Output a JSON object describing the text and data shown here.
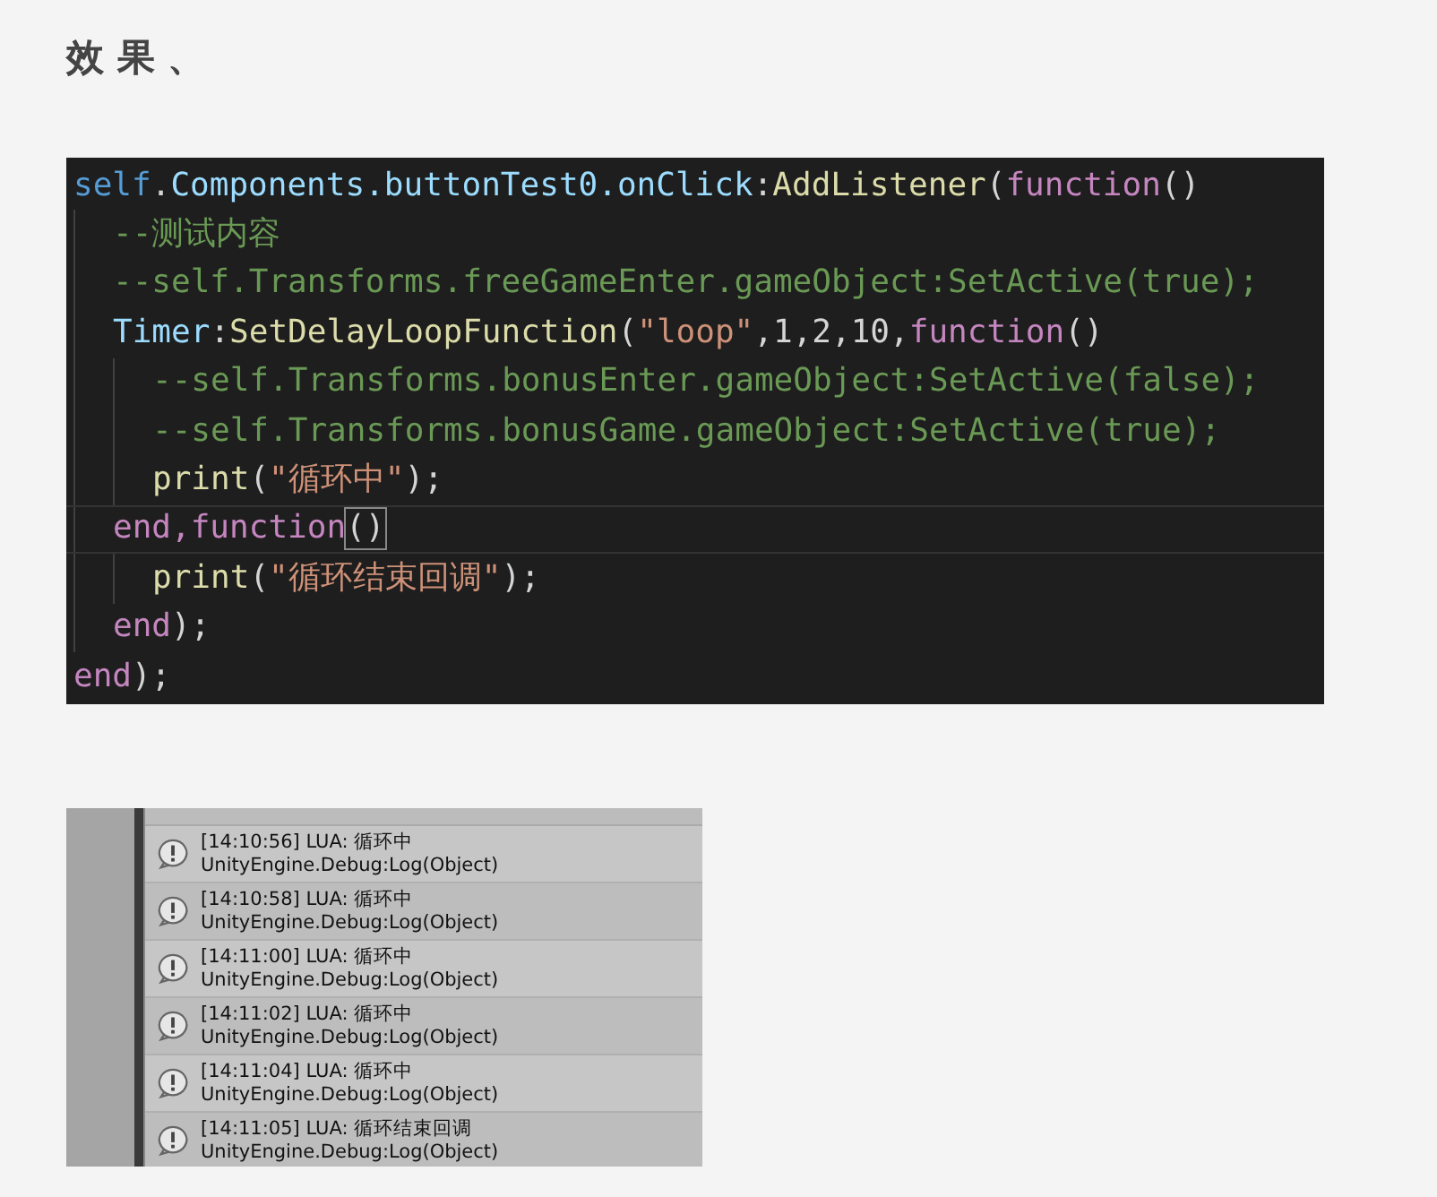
{
  "heading": "效 果 、",
  "code": {
    "lines": [
      {
        "current": false,
        "tokens": [
          {
            "kind": "self",
            "text": "self"
          },
          {
            "kind": "plain",
            "text": "."
          },
          {
            "kind": "member",
            "text": "Components.buttonTest0.onClick"
          },
          {
            "kind": "plain",
            "text": ":"
          },
          {
            "kind": "func",
            "text": "AddListener"
          },
          {
            "kind": "plain",
            "text": "("
          },
          {
            "kind": "keyword",
            "text": "function"
          },
          {
            "kind": "plain",
            "text": "()"
          }
        ],
        "children": [
          {
            "current": false,
            "tokens": [
              {
                "kind": "comment",
                "text": "--测试内容"
              }
            ]
          },
          {
            "current": false,
            "tokens": [
              {
                "kind": "comment",
                "text": "--self.Transforms.freeGameEnter.gameObject:SetActive(true);"
              }
            ]
          },
          {
            "current": false,
            "tokens": [
              {
                "kind": "member",
                "text": "Timer"
              },
              {
                "kind": "plain",
                "text": ":"
              },
              {
                "kind": "func",
                "text": "SetDelayLoopFunction"
              },
              {
                "kind": "plain",
                "text": "("
              },
              {
                "kind": "string",
                "text": "\"loop\""
              },
              {
                "kind": "plain",
                "text": ",1,2,10,"
              },
              {
                "kind": "keyword",
                "text": "function"
              },
              {
                "kind": "plain",
                "text": "()"
              }
            ],
            "children": [
              {
                "current": false,
                "tokens": [
                  {
                    "kind": "comment",
                    "text": "--self.Transforms.bonusEnter.gameObject:SetActive(false);"
                  }
                ]
              },
              {
                "current": false,
                "tokens": [
                  {
                    "kind": "comment",
                    "text": "--self.Transforms.bonusGame.gameObject:SetActive(true);"
                  }
                ]
              },
              {
                "current": false,
                "tokens": [
                  {
                    "kind": "func",
                    "text": "print"
                  },
                  {
                    "kind": "plain",
                    "text": "("
                  },
                  {
                    "kind": "string",
                    "text": "\"循环中\""
                  },
                  {
                    "kind": "plain",
                    "text": ");"
                  }
                ]
              }
            ]
          },
          {
            "current": true,
            "tokens": [
              {
                "kind": "keyword",
                "text": "end,function"
              },
              {
                "kind": "bracket",
                "text": "()"
              }
            ],
            "children": [
              {
                "current": false,
                "tokens": [
                  {
                    "kind": "func",
                    "text": "print"
                  },
                  {
                    "kind": "plain",
                    "text": "("
                  },
                  {
                    "kind": "string",
                    "text": "\"循环结束回调\""
                  },
                  {
                    "kind": "plain",
                    "text": ");"
                  }
                ]
              }
            ]
          },
          {
            "current": false,
            "tokens": [
              {
                "kind": "keyword",
                "text": "end"
              },
              {
                "kind": "plain",
                "text": ");"
              }
            ]
          }
        ]
      },
      {
        "current": false,
        "tokens": [
          {
            "kind": "keyword",
            "text": "end"
          },
          {
            "kind": "plain",
            "text": ");"
          }
        ]
      }
    ]
  },
  "console": {
    "entries": [
      {
        "message": "[14:10:56] LUA: 循环中",
        "trace": "UnityEngine.Debug:Log(Object)"
      },
      {
        "message": "[14:10:58] LUA: 循环中",
        "trace": "UnityEngine.Debug:Log(Object)"
      },
      {
        "message": "[14:11:00] LUA: 循环中",
        "trace": "UnityEngine.Debug:Log(Object)"
      },
      {
        "message": "[14:11:02] LUA: 循环中",
        "trace": "UnityEngine.Debug:Log(Object)"
      },
      {
        "message": "[14:11:04] LUA: 循环中",
        "trace": "UnityEngine.Debug:Log(Object)"
      },
      {
        "message": "[14:11:05] LUA: 循环结束回调",
        "trace": "UnityEngine.Debug:Log(Object)"
      }
    ]
  }
}
